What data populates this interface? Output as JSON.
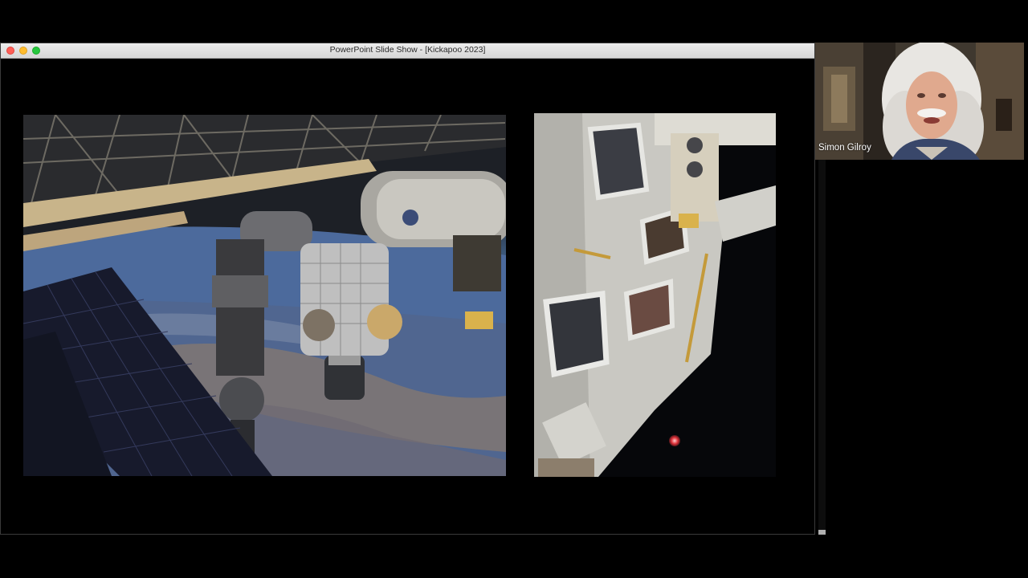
{
  "window": {
    "title": "PowerPoint Slide Show - [Kickapoo 2023]"
  },
  "slide": {
    "left_image": "space-station-over-earth",
    "right_image": "space-station-cupola",
    "pointer": "laser-pointer-dot"
  },
  "webcam": {
    "participant_name": "Simon Gilroy"
  },
  "colors": {
    "laser": "#e0323a",
    "close": "#fe5f57",
    "minimize": "#febc2e",
    "maximize": "#28c840"
  }
}
